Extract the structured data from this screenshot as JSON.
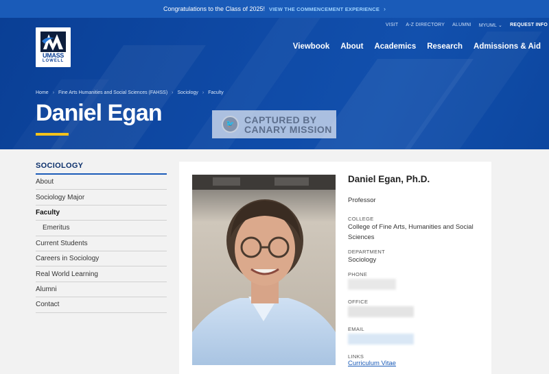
{
  "announcement": {
    "text": "Congratulations to the Class of 2025!",
    "link": "VIEW THE COMMENCEMENT EXPERIENCE"
  },
  "logo": {
    "line1": "UMASS",
    "line2": "LOWELL"
  },
  "utility_nav": [
    "VISIT",
    "A-Z DIRECTORY",
    "ALUMNI",
    "MYUML",
    "REQUEST INFO"
  ],
  "main_nav": [
    "Viewbook",
    "About",
    "Academics",
    "Research",
    "Admissions & Aid"
  ],
  "breadcrumb": [
    "Home",
    "Fine Arts Humanities and Social Sciences (FAHSS)",
    "Sociology",
    "Faculty"
  ],
  "page_title": "Daniel Egan",
  "watermark": {
    "line1": "CAPTURED BY",
    "line2": "CANARY MISSION"
  },
  "sidebar": {
    "heading": "SOCIOLOGY",
    "items": [
      {
        "label": "About"
      },
      {
        "label": "Sociology Major"
      },
      {
        "label": "Faculty"
      },
      {
        "label": "Emeritus"
      },
      {
        "label": "Current Students"
      },
      {
        "label": "Careers in Sociology"
      },
      {
        "label": "Real World Learning"
      },
      {
        "label": "Alumni"
      },
      {
        "label": "Contact"
      }
    ]
  },
  "profile": {
    "name": "Daniel Egan, Ph.D.",
    "role": "Professor",
    "college_label": "COLLEGE",
    "college": "College of Fine Arts, Humanities and Social Sciences",
    "department_label": "DEPARTMENT",
    "department": "Sociology",
    "phone_label": "PHONE",
    "office_label": "OFFICE",
    "email_label": "EMAIL",
    "links_label": "LINKS",
    "cv_link": "Curriculum Vitae"
  },
  "colors": {
    "header_blue": "#0f4aa6",
    "announce_blue": "#1a5bb8",
    "accent_yellow": "#f3c21b",
    "link_blue": "#1a5bb8"
  }
}
